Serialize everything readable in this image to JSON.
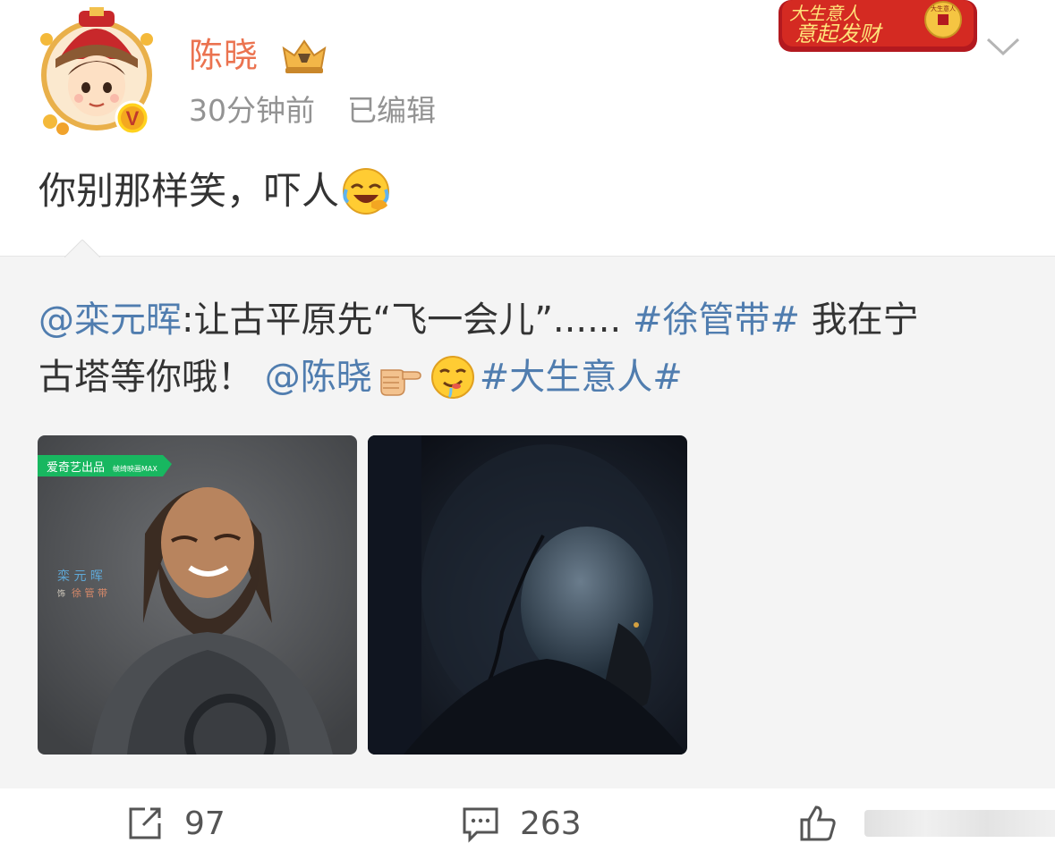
{
  "author": {
    "name": "陈晓",
    "time": "30分钟前",
    "edited": "已编辑"
  },
  "post": {
    "text": "你别那样笑，吓人"
  },
  "repost": {
    "mention": "@栾元晖",
    "colon_text": ":让古平原先“飞一会儿”......",
    "topic1": "#徐管带#",
    "text_after_topic": "我在宁",
    "line2_text": "古塔等你哦！",
    "mention2": "@陈晓",
    "topic2": "#大生意人#",
    "photo1": {
      "brand": "爱奇艺出品",
      "brand2": "帧绮映画MAX",
      "actor_name": "栾 元 晖",
      "role_prefix": "饰",
      "role_name": "徐 管 带"
    }
  },
  "badge": {
    "text": "大生意人 意起发财",
    "coin_text": "大生意人"
  },
  "actions": {
    "repost_count": "97",
    "comment_count": "263"
  },
  "colors": {
    "name": "#eb7350",
    "link": "#507daf",
    "meta": "#939393"
  },
  "icons": {
    "repost": "share-arrow-icon",
    "comment": "comment-bubble-icon",
    "like": "thumbs-up-icon",
    "menu": "chevron-down-icon"
  }
}
